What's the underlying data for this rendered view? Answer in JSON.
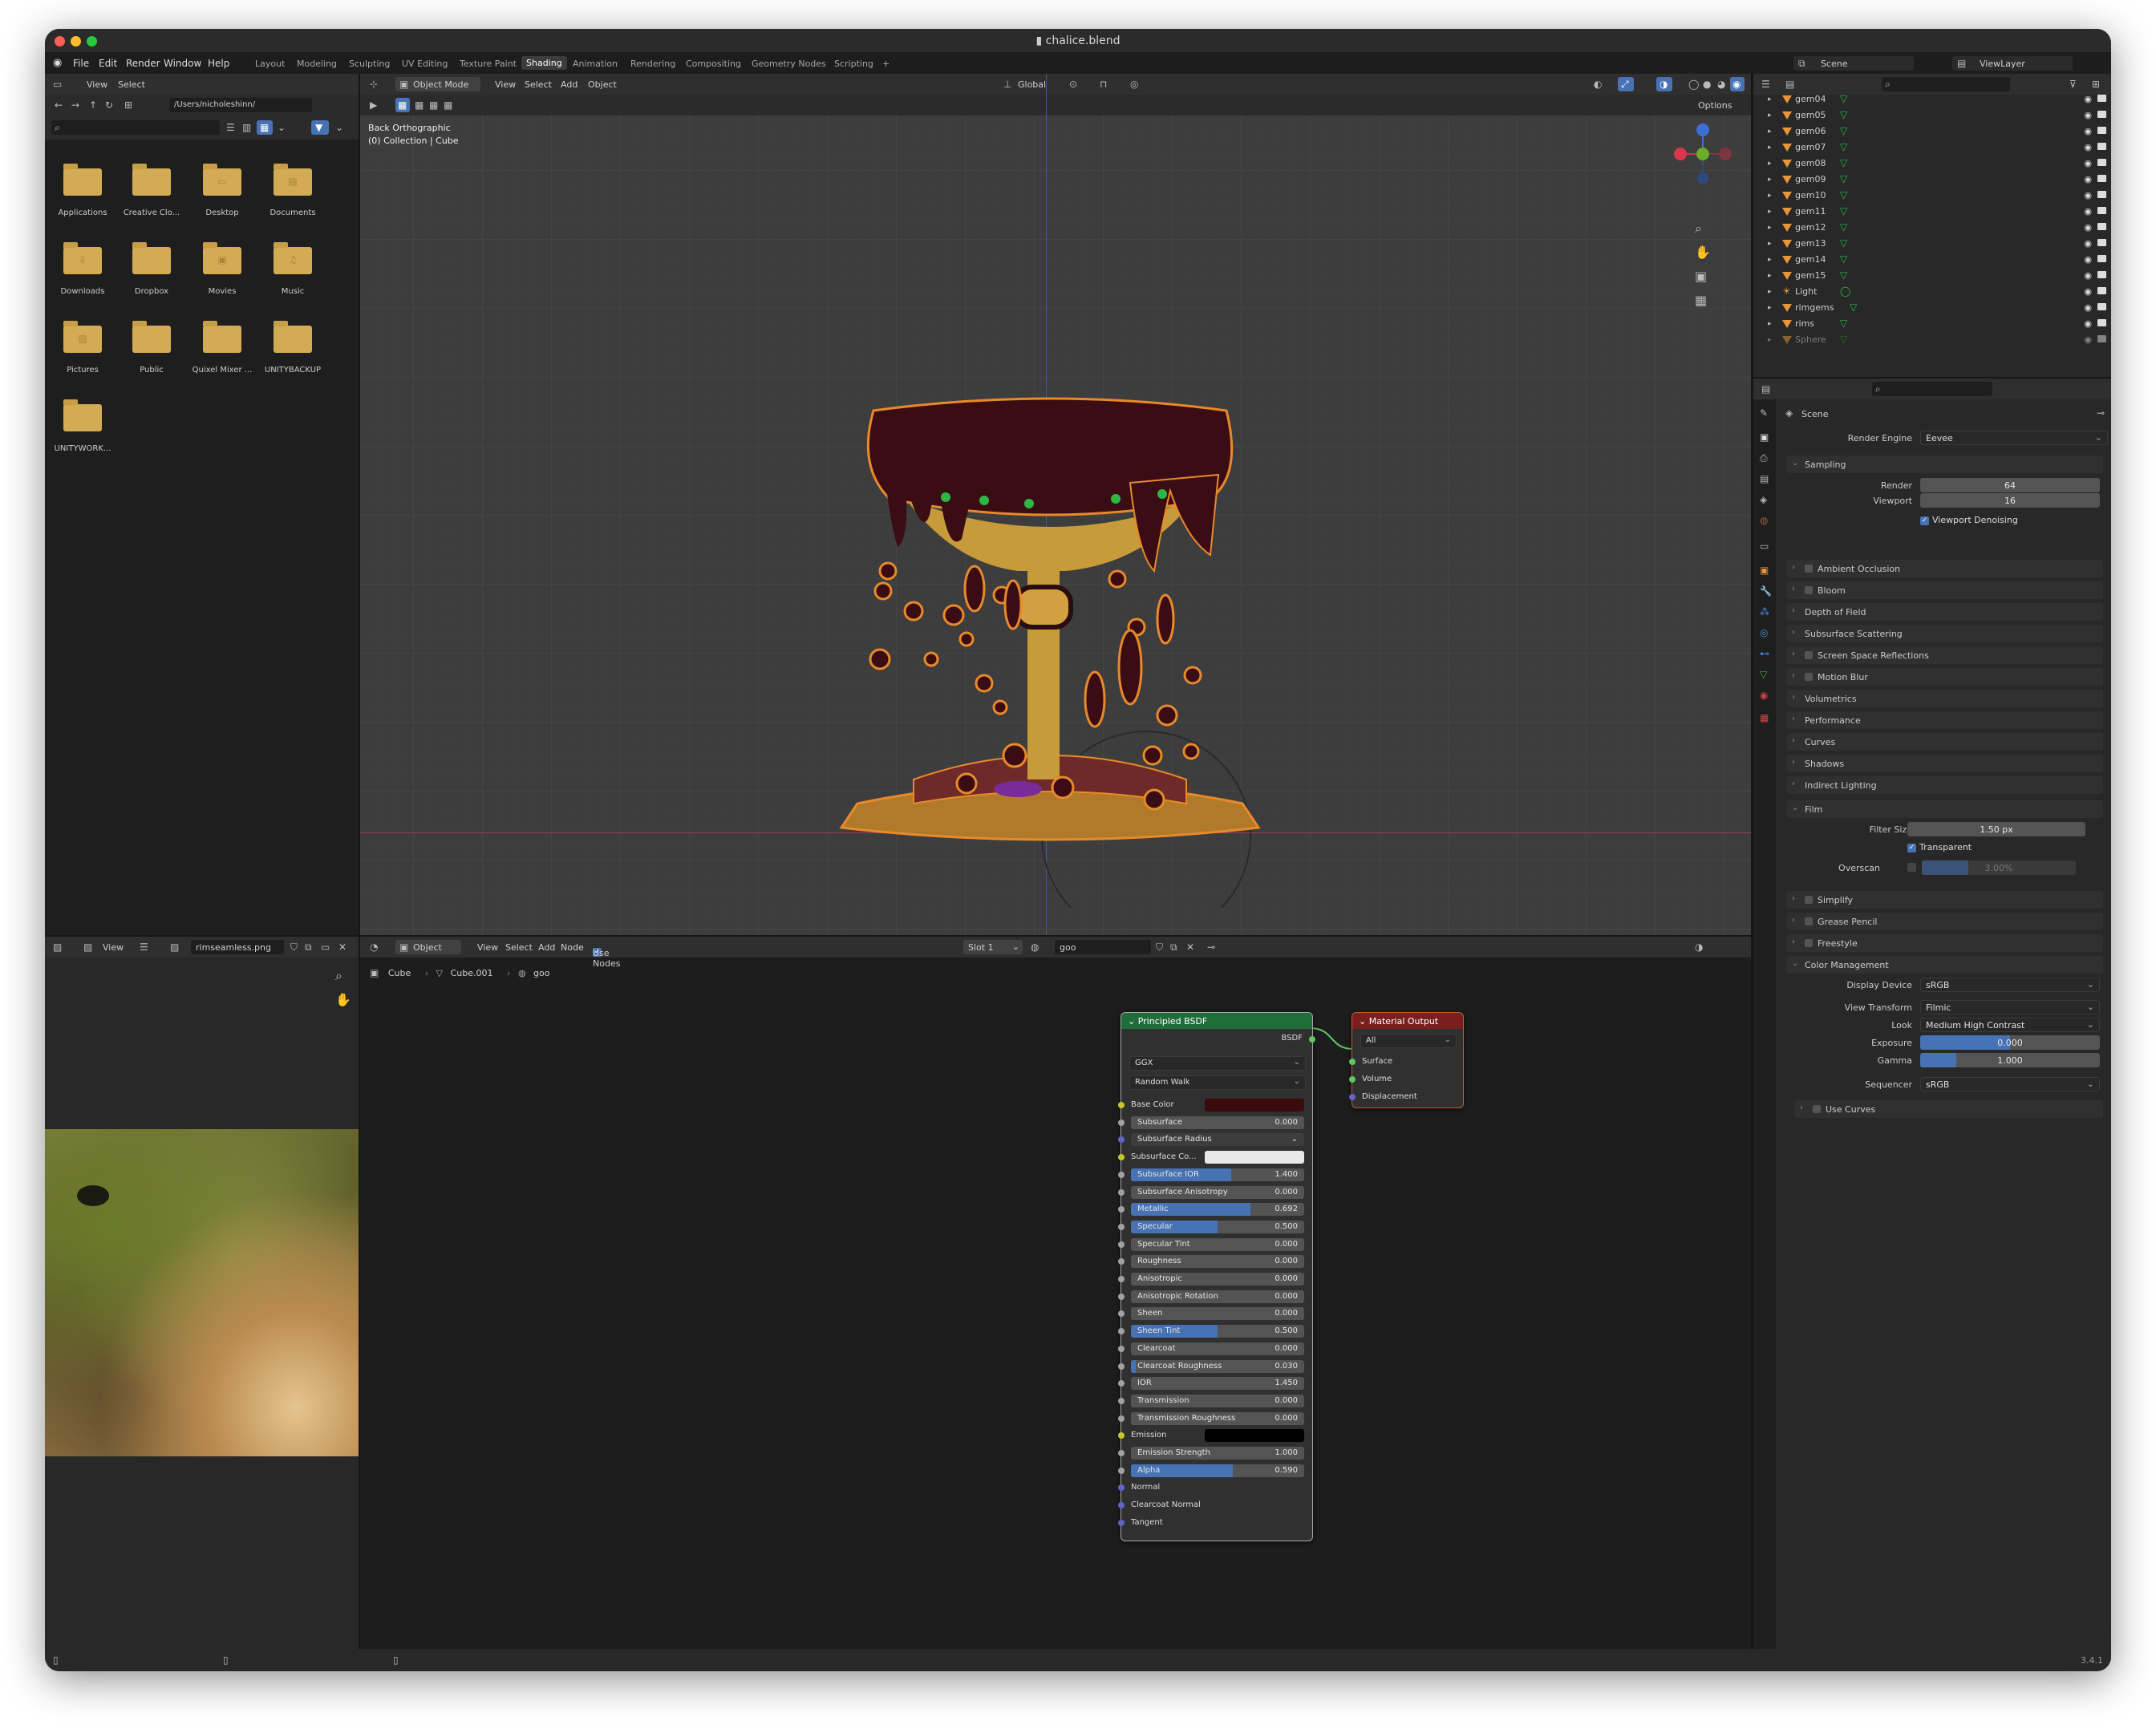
{
  "window": {
    "title": "chalice.blend"
  },
  "menu": [
    "File",
    "Edit",
    "Render",
    "Window",
    "Help"
  ],
  "workspaces": [
    "Layout",
    "Modeling",
    "Sculpting",
    "UV Editing",
    "Texture Paint",
    "Shading",
    "Animation",
    "Rendering",
    "Compositing",
    "Geometry Nodes",
    "Scripting",
    "+"
  ],
  "active_workspace": "Shading",
  "topright": {
    "scene": "Scene",
    "viewlayer": "ViewLayer"
  },
  "filebrowser": {
    "view": "View",
    "select": "Select",
    "path": "/Users/nicholeshinn/",
    "folders": [
      "Applications",
      "Creative Clo...",
      "Desktop",
      "Documents",
      "Downloads",
      "Dropbox",
      "Movies",
      "Music",
      "Pictures",
      "Public",
      "Quixel Mixer ...",
      "UNITYBACKUP",
      "UNITYWORK..."
    ]
  },
  "viewport": {
    "mode": "Object Mode",
    "menus": [
      "View",
      "Select",
      "Add",
      "Object"
    ],
    "transform": "Global",
    "options": "Options",
    "overlay_line1": "Back Orthographic",
    "overlay_line2": "(0) Collection | Cube"
  },
  "outliner": {
    "items": [
      "gem04",
      "gem05",
      "gem06",
      "gem07",
      "gem08",
      "gem09",
      "gem10",
      "gem11",
      "gem12",
      "gem13",
      "gem14",
      "gem15",
      "Light",
      "rimgems",
      "rims",
      "Sphere"
    ]
  },
  "properties": {
    "scene": "Scene",
    "render_engine_label": "Render Engine",
    "render_engine": "Eevee",
    "sampling": "Sampling",
    "render_label": "Render",
    "render": "64",
    "viewport_label": "Viewport",
    "viewport": "16",
    "denoise": "Viewport Denoising",
    "sections_a": [
      "Ambient Occlusion",
      "Bloom",
      "Depth of Field",
      "Subsurface Scattering",
      "Screen Space Reflections",
      "Motion Blur",
      "Volumetrics",
      "Performance",
      "Curves",
      "Shadows",
      "Indirect Lighting"
    ],
    "film": "Film",
    "filter_label": "Filter Size",
    "filter": "1.50 px",
    "transparent": "Transparent",
    "overscan_label": "Overscan",
    "overscan": "3.00%",
    "sections_b": [
      "Simplify",
      "Grease Pencil",
      "Freestyle"
    ],
    "cm": "Color Management",
    "display_label": "Display Device",
    "display": "sRGB",
    "view_label": "View Transform",
    "view": "Filmic",
    "look_label": "Look",
    "look": "Medium High Contrast",
    "exposure_label": "Exposure",
    "exposure": "0.000",
    "gamma_label": "Gamma",
    "gamma": "1.000",
    "seq_label": "Sequencer",
    "seq": "sRGB",
    "curves": "Use Curves"
  },
  "image_editor": {
    "view": "View",
    "image": "rimseamless.png"
  },
  "node_editor": {
    "object": "Object",
    "menus": [
      "View",
      "Select",
      "Add",
      "Node"
    ],
    "use_nodes": "Use Nodes",
    "slot": "Slot 1",
    "material": "goo",
    "breadcrumb": [
      "Cube",
      "Cube.001",
      "goo"
    ]
  },
  "bsdf": {
    "title": "Principled BSDF",
    "output": "BSDF",
    "distribution": "GGX",
    "sss_method": "Random Walk",
    "rows": [
      {
        "label": "Base Color",
        "kind": "color",
        "color": "#3a0a0c",
        "sock": "#c7c729"
      },
      {
        "label": "Subsurface",
        "value": "0.000",
        "fill": 0,
        "sock": "#a1a1a1"
      },
      {
        "label": "Subsurface Radius",
        "kind": "vec",
        "sock": "#6363c7"
      },
      {
        "label": "Subsurface Co...",
        "kind": "color",
        "color": "#e8e8e8",
        "sock": "#c7c729"
      },
      {
        "label": "Subsurface IOR",
        "value": "1.400",
        "fill": 0.58,
        "sock": "#a1a1a1"
      },
      {
        "label": "Subsurface Anisotropy",
        "value": "0.000",
        "fill": 0,
        "sock": "#a1a1a1"
      },
      {
        "label": "Metallic",
        "value": "0.692",
        "fill": 0.692,
        "sock": "#a1a1a1"
      },
      {
        "label": "Specular",
        "value": "0.500",
        "fill": 0.5,
        "sock": "#a1a1a1"
      },
      {
        "label": "Specular Tint",
        "value": "0.000",
        "fill": 0,
        "sock": "#a1a1a1"
      },
      {
        "label": "Roughness",
        "value": "0.000",
        "fill": 0,
        "sock": "#a1a1a1"
      },
      {
        "label": "Anisotropic",
        "value": "0.000",
        "fill": 0,
        "sock": "#a1a1a1"
      },
      {
        "label": "Anisotropic Rotation",
        "value": "0.000",
        "fill": 0,
        "sock": "#a1a1a1"
      },
      {
        "label": "Sheen",
        "value": "0.000",
        "fill": 0,
        "sock": "#a1a1a1"
      },
      {
        "label": "Sheen Tint",
        "value": "0.500",
        "fill": 0.5,
        "sock": "#a1a1a1"
      },
      {
        "label": "Clearcoat",
        "value": "0.000",
        "fill": 0,
        "sock": "#a1a1a1"
      },
      {
        "label": "Clearcoat Roughness",
        "value": "0.030",
        "fill": 0.03,
        "sock": "#a1a1a1"
      },
      {
        "label": "IOR",
        "value": "1.450",
        "fill": 0,
        "sock": "#a1a1a1"
      },
      {
        "label": "Transmission",
        "value": "0.000",
        "fill": 0,
        "sock": "#a1a1a1"
      },
      {
        "label": "Transmission Roughness",
        "value": "0.000",
        "fill": 0,
        "sock": "#a1a1a1"
      },
      {
        "label": "Emission",
        "kind": "color",
        "color": "#000000",
        "sock": "#c7c729"
      },
      {
        "label": "Emission Strength",
        "value": "1.000",
        "fill": 0,
        "sock": "#a1a1a1"
      },
      {
        "label": "Alpha",
        "value": "0.590",
        "fill": 0.59,
        "sock": "#a1a1a1"
      },
      {
        "label": "Normal",
        "kind": "plain",
        "sock": "#6363c7"
      },
      {
        "label": "Clearcoat Normal",
        "kind": "plain",
        "sock": "#6363c7"
      },
      {
        "label": "Tangent",
        "kind": "plain",
        "sock": "#6363c7"
      }
    ]
  },
  "matout": {
    "title": "Material Output",
    "target": "All",
    "inputs": [
      "Surface",
      "Volume",
      "Displacement"
    ]
  },
  "status": {
    "version": "3.4.1"
  },
  "colors": {
    "accent": "#4772b3",
    "bsdf_header": "#1f6e3a",
    "output_header": "#7a1f1f",
    "gold": "#d4ab55"
  }
}
